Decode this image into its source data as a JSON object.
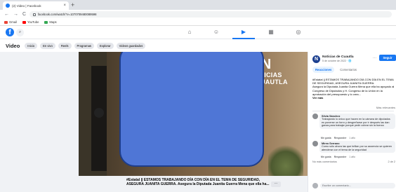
{
  "browser": {
    "tab_title": "(2) Video | Facebook",
    "tab_close": "×",
    "new_tab": "+",
    "back": "←",
    "forward": "→",
    "reload": "C",
    "url": "facebook.com/watch/?v=1070709480089598",
    "bookmarks": [
      "Gmail",
      "YouTube",
      "Maps"
    ],
    "bookmark_colors": [
      "#ea4335",
      "#ff0000",
      "#34a853"
    ]
  },
  "facebook": {
    "logo": "f",
    "search_icon": "search-icon",
    "nav": [
      {
        "name": "home",
        "glyph": "⌂"
      },
      {
        "name": "friends",
        "glyph": "☺"
      },
      {
        "name": "watch",
        "glyph": "▶"
      },
      {
        "name": "marketplace",
        "glyph": "▦"
      },
      {
        "name": "gaming",
        "glyph": "◎"
      }
    ],
    "active_nav": "watch",
    "accent": "#1877f2"
  },
  "video_bar": {
    "title": "Video",
    "chips": [
      "Inicio",
      "En vivo",
      "Reels",
      "Programas",
      "Explorar",
      "Videos guardados"
    ]
  },
  "player": {
    "overlay_logo_letter": "N",
    "overlay_logo_line1": "NOTICIAS",
    "overlay_logo_line2": "DE CUAUTLA",
    "caption": "#Estatal || ESTAMOS TRABAJANDO DÍA CON DÍA EN EL TEMA DE SEGURIDAD, ASEGURA JUANITA GUERRA. Asegura la Diputada Juanita Guerra Mena que ella ha...",
    "more_button": "···"
  },
  "panel": {
    "page_initial": "N",
    "page_name": "Noticias de Cuautla",
    "date": "5 de octubre de 2022 · 🌐",
    "follow": "Seguir",
    "tabs": [
      "Reacciones",
      "Comentarios"
    ],
    "post_title": "#Estatal || ESTAMOS TRABAJANDO DÍA CON DÍA EN EL TEMA DE SEGURIDAD, ASEGURA JUANITA GUERRA.",
    "post_body": "Asegura la Diputada Juanita Guerra Mena que ella ha apoyado al Congreso de Diputados y H. Congreso de la Unión en la aprobación del presupuesto y lo crea...",
    "see_more": "Ver más",
    "more_comments": "Más relevantes",
    "comments": [
      {
        "name": "Silvia Sánchez",
        "text": "Trabajando lo único que hacen en la cámara de diputados es ponerse un forro y desgreñarse por ir después las dan ganas para trabajar porque pedir cobrar sin la fuerza",
        "like": "Me gusta",
        "reply": "Responder",
        "time": "1 año"
      },
      {
        "name": "Mireo Serrano",
        "text": "Como sólo ahora las que brillan por su ausencia se quieren atenderar con el tema de la seguridad",
        "like": "Me gusta",
        "reply": "Responder",
        "time": "1 año"
      }
    ],
    "no_more": "No más comentarios",
    "count": "2 de 2",
    "write_placeholder": "Escribe un comentario..."
  }
}
